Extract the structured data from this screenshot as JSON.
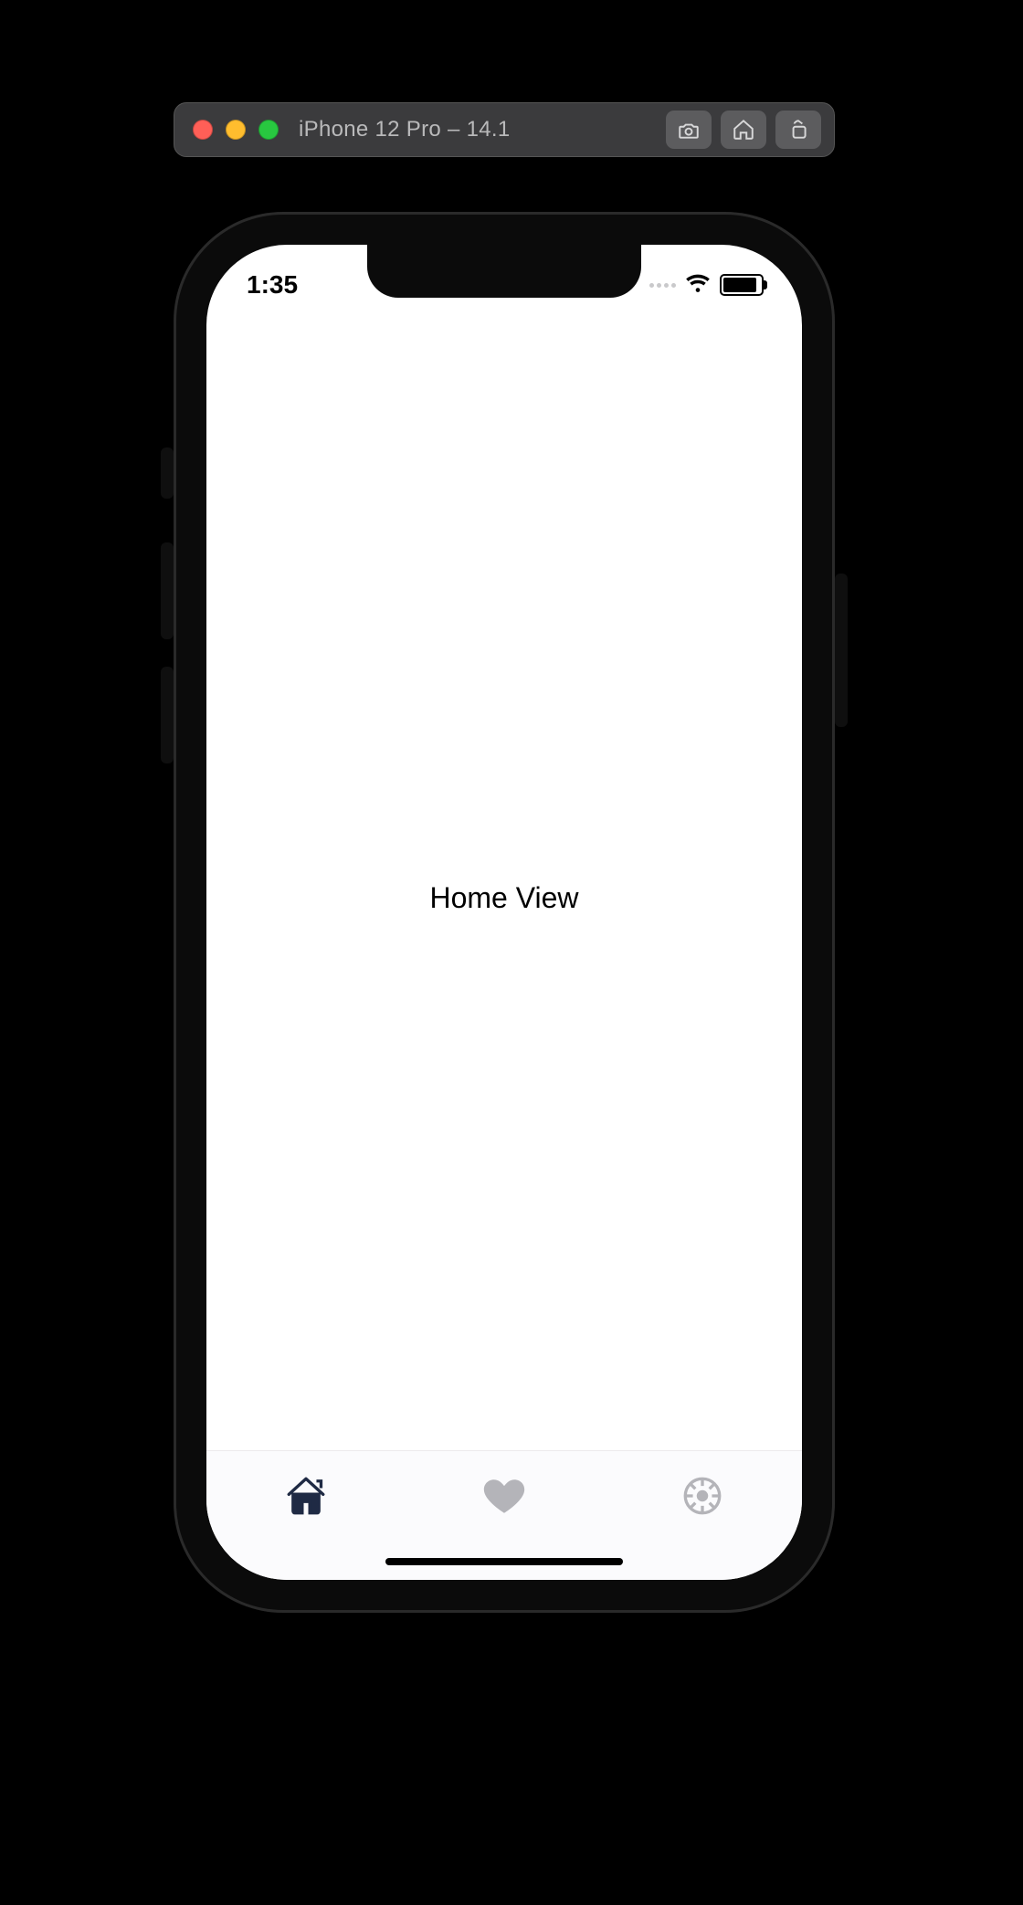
{
  "simulator": {
    "title": "iPhone 12 Pro – 14.1",
    "toolbar": {
      "screenshot": "screenshot-icon",
      "home": "home-icon",
      "share": "share-icon"
    }
  },
  "status_bar": {
    "time": "1:35"
  },
  "content": {
    "label": "Home View"
  },
  "tabbar": {
    "items": [
      {
        "name": "home-tab",
        "icon": "house-icon",
        "active": true
      },
      {
        "name": "favorites-tab",
        "icon": "heart-icon",
        "active": false
      },
      {
        "name": "settings-tab",
        "icon": "gear-icon",
        "active": false
      }
    ]
  }
}
